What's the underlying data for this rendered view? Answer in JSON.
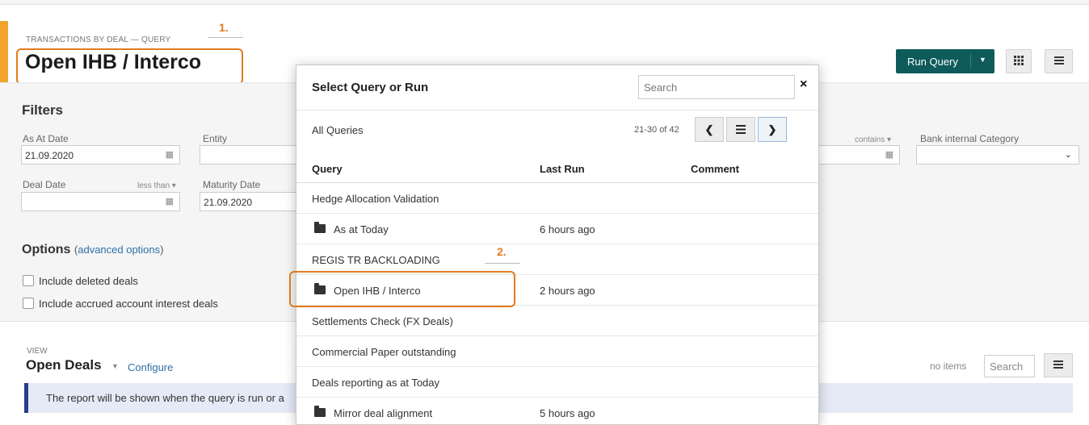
{
  "header": {
    "subtitle": "TRANSACTIONS BY DEAL — QUERY",
    "title": "Open IHB / Interco",
    "run_query_label": "Run Query"
  },
  "annotations": {
    "step1": "1.",
    "step2": "2."
  },
  "filters": {
    "heading": "Filters",
    "as_at_date_label": "As At Date",
    "as_at_date_value": "21.09.2020",
    "entity_label": "Entity",
    "deal_date_label": "Deal Date",
    "deal_date_operator": "less than",
    "maturity_date_label": "Maturity Date",
    "maturity_date_value": "21.09.2020",
    "contains_operator": "contains",
    "bank_internal_category_label": "Bank internal Category"
  },
  "options": {
    "heading": "Options",
    "advanced_link": "advanced options",
    "include_deleted": "Include deleted deals",
    "include_accrued": "Include accrued account interest deals"
  },
  "view": {
    "label": "VIEW",
    "title": "Open Deals",
    "configure": "Configure",
    "info": "The report will be shown when the query is run or a",
    "no_items": "no items",
    "search_placeholder": "Search"
  },
  "modal": {
    "title": "Select Query or Run",
    "search_placeholder": "Search",
    "close": "×",
    "all_queries": "All Queries",
    "pager_text": "21-30 of 42",
    "columns": {
      "query": "Query",
      "last_run": "Last Run",
      "comment": "Comment"
    },
    "rows": [
      {
        "name": "Hedge Allocation Validation",
        "last_run": "",
        "folder": false
      },
      {
        "name": "As at Today",
        "last_run": "6 hours ago",
        "folder": true
      },
      {
        "name": "REGIS TR BACKLOADING",
        "last_run": "",
        "folder": false
      },
      {
        "name": "Open IHB / Interco",
        "last_run": "2 hours ago",
        "folder": true
      },
      {
        "name": "Settlements Check (FX Deals)",
        "last_run": "",
        "folder": false
      },
      {
        "name": "Commercial Paper outstanding",
        "last_run": "",
        "folder": false
      },
      {
        "name": "Deals reporting as at Today",
        "last_run": "",
        "folder": false
      },
      {
        "name": "Mirror deal alignment",
        "last_run": "5 hours ago",
        "folder": true
      }
    ]
  },
  "icons": {
    "calendar": "calendar-icon",
    "grid": "grid-icon",
    "menu": "hamburger-menu-icon",
    "folder": "folder-icon"
  },
  "colors": {
    "accent_orange": "#f0a52a",
    "annotation_orange": "#e07b1e",
    "run_query_teal": "#0f5b5b",
    "info_bar_border": "#2a3e8c",
    "link_blue": "#2f6fa7"
  }
}
